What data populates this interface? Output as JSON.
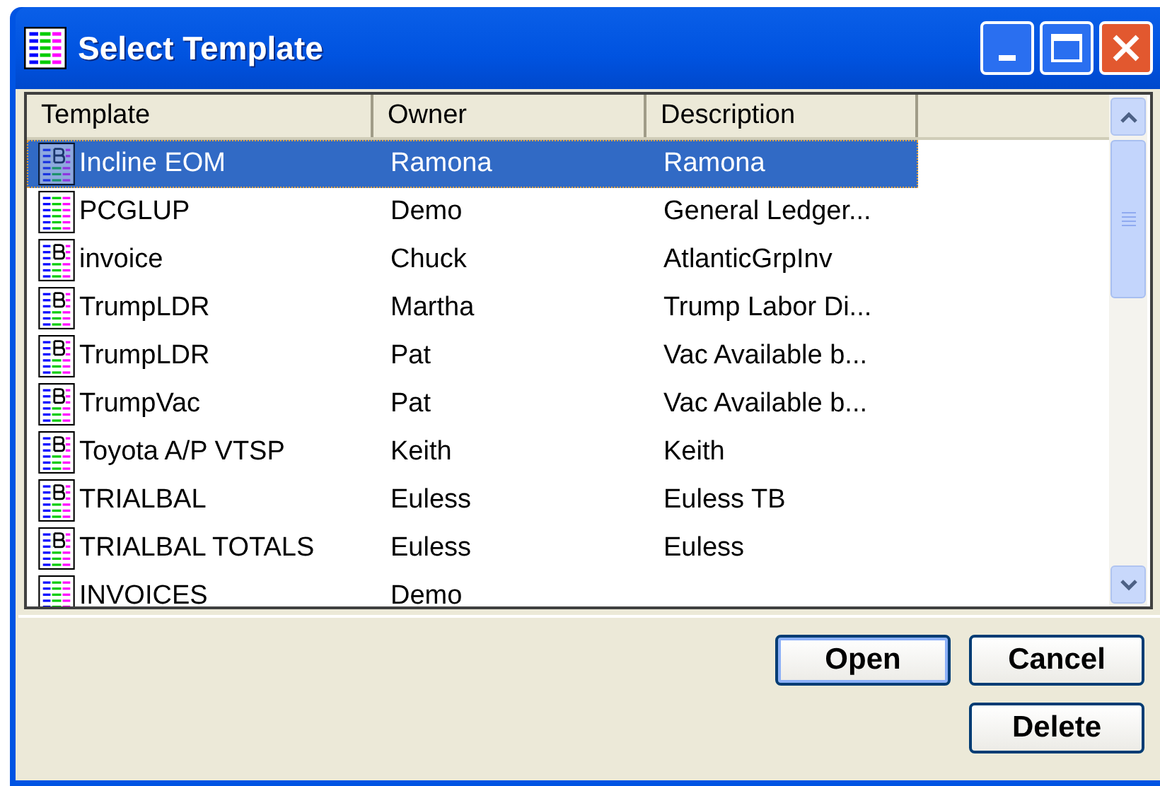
{
  "window": {
    "title": "Select Template"
  },
  "table": {
    "columns": [
      "Template",
      "Owner",
      "Description"
    ],
    "rows": [
      {
        "kind": "report",
        "template": "Incline EOM",
        "owner": "Ramona",
        "description": "Ramona",
        "selected": true
      },
      {
        "kind": "ledger",
        "template": "PCGLUP",
        "owner": "Demo",
        "description": "General Ledger...",
        "selected": false
      },
      {
        "kind": "report",
        "template": "invoice",
        "owner": "Chuck",
        "description": "AtlanticGrpInv",
        "selected": false
      },
      {
        "kind": "report",
        "template": "TrumpLDR",
        "owner": "Martha",
        "description": "Trump Labor Di...",
        "selected": false
      },
      {
        "kind": "report",
        "template": "TrumpLDR",
        "owner": "Pat",
        "description": "Vac Available b...",
        "selected": false
      },
      {
        "kind": "report",
        "template": "TrumpVac",
        "owner": "Pat",
        "description": "Vac Available b...",
        "selected": false
      },
      {
        "kind": "report",
        "template": "Toyota A/P VTSP",
        "owner": "Keith",
        "description": "Keith",
        "selected": false
      },
      {
        "kind": "report",
        "template": "TRIALBAL",
        "owner": "Euless",
        "description": "Euless TB",
        "selected": false
      },
      {
        "kind": "report",
        "template": "TRIALBAL TOTALS",
        "owner": "Euless",
        "description": "Euless",
        "selected": false
      },
      {
        "kind": "ledger",
        "template": "INVOICES",
        "owner": "Demo",
        "selected": false
      }
    ]
  },
  "buttons": [
    {
      "label": "Open",
      "default": true
    },
    {
      "label": "Cancel",
      "default": false
    },
    {
      "label": "Delete",
      "default": false
    }
  ]
}
